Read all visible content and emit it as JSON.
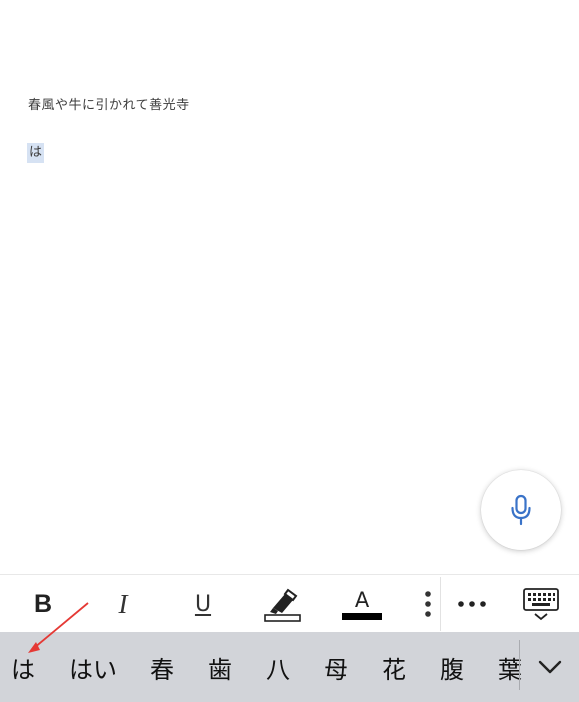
{
  "document": {
    "lines": [
      "春風や牛に引かれて善光寺",
      "は"
    ]
  },
  "fab": {
    "icon": "microphone-icon",
    "color": "#3a73c8"
  },
  "toolbar": {
    "bold": "B",
    "italic": "I",
    "underline": "U",
    "font_color_letter": "A",
    "highlight_icon": "highlighter-icon",
    "overflow_icon": "vertical-dots-icon",
    "more_icon": "horizontal-dots-icon",
    "keyboard_icon": "keyboard-hide-icon"
  },
  "suggestions": [
    "は",
    "はい",
    "春",
    "歯",
    "八",
    "母",
    "花",
    "腹",
    "葉"
  ],
  "colors": {
    "annotation_arrow": "#e53935",
    "suggestion_bar": "#d2d4d9",
    "selection": "#d6e2f3"
  }
}
